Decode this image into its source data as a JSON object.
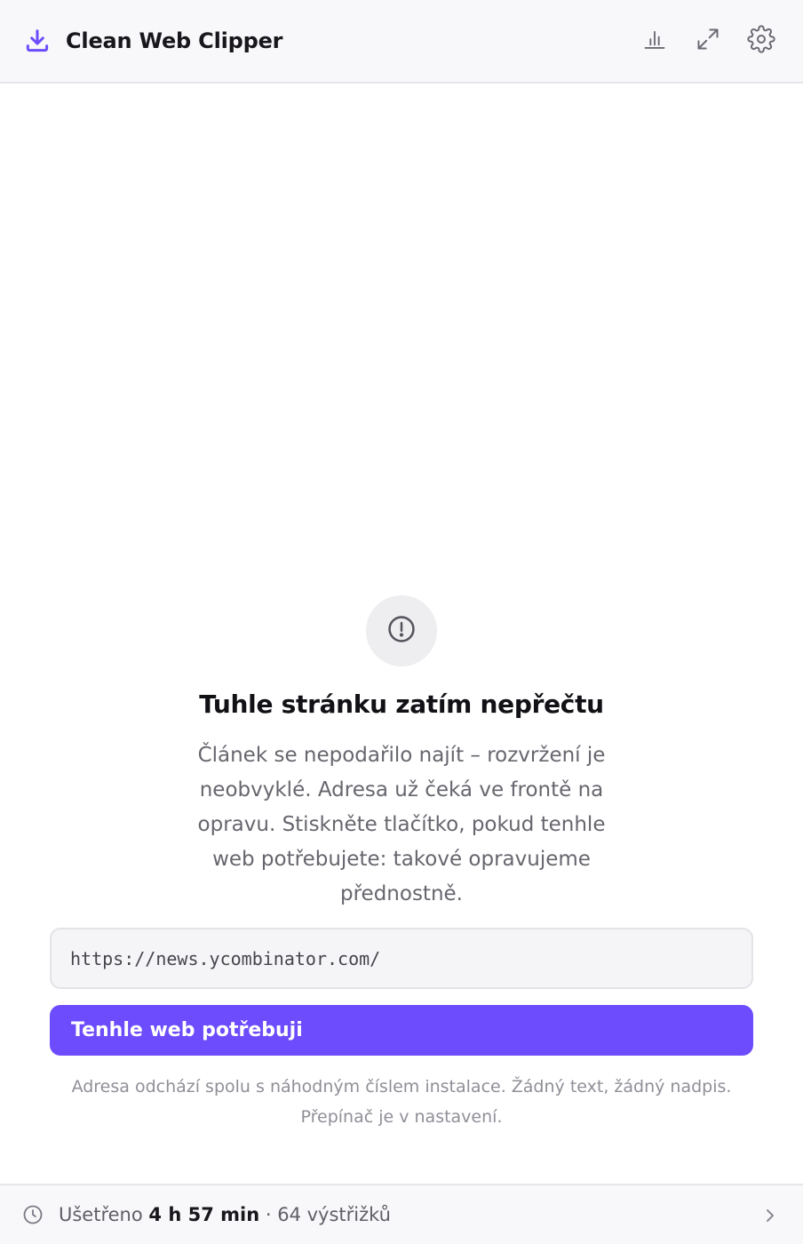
{
  "app": {
    "title": "Clean Web Clipper",
    "accent_color": "#6c4cfc"
  },
  "header": {
    "icons": [
      "download-icon",
      "bar-chart-icon",
      "expand-icon",
      "gear-icon"
    ]
  },
  "empty_state": {
    "icon": "alert-circle-icon",
    "title": "Tuhle stránku zatím nepřečtu",
    "description": "Článek se nepodařilo najít – rozvržení je neobvyklé. Adresa už čeká ve frontě na opravu. Stiskněte tlačítko, pokud tenhle web potřebujete: takové opravujeme přednostně.",
    "url_value": "https://news.ycombinator.com/",
    "button_label": "Tenhle web potřebuji",
    "privacy_note": "Adresa odchází spolu s náhodným číslem instalace. Žádný text, žádný nadpis. Přepínač je v nastavení."
  },
  "footer": {
    "saved_label": "Ušetřeno",
    "saved_time": "4 h 57 min",
    "separator": "·",
    "clips_count": "64 výstřižků",
    "icons": [
      "clock-icon",
      "chevron-right-icon"
    ]
  }
}
